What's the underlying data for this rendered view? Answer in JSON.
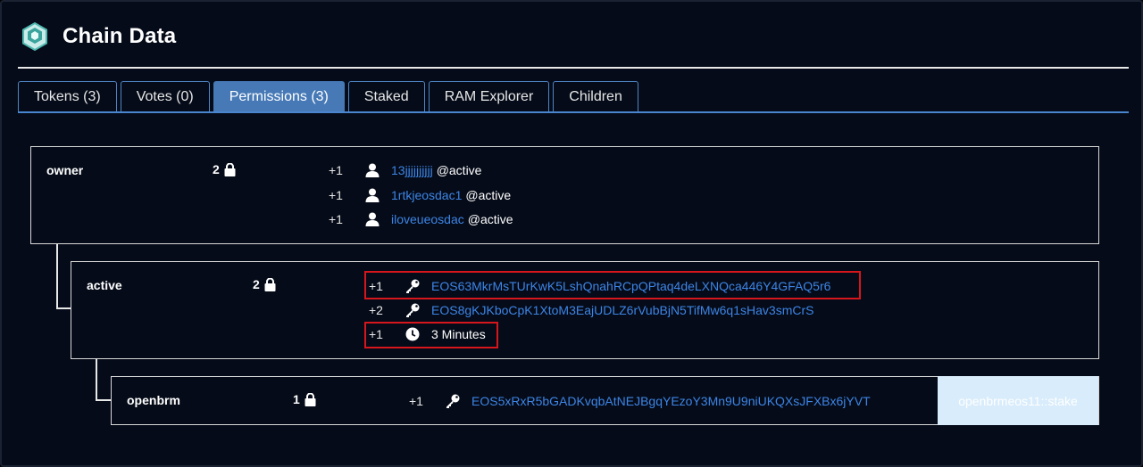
{
  "header": {
    "title": "Chain Data",
    "logo_icon": "chain-cube-icon"
  },
  "tabs": [
    {
      "label": "Tokens (3)",
      "active": false
    },
    {
      "label": "Votes (0)",
      "active": false
    },
    {
      "label": "Permissions (3)",
      "active": true
    },
    {
      "label": "Staked",
      "active": false
    },
    {
      "label": "RAM Explorer",
      "active": false
    },
    {
      "label": "Children",
      "active": false
    }
  ],
  "permissions": {
    "owner": {
      "name": "owner",
      "threshold": "2",
      "entries": [
        {
          "weight": "+1",
          "icon": "user-icon",
          "account": "13jjjjjjjjjj",
          "perm": "@active"
        },
        {
          "weight": "+1",
          "icon": "user-icon",
          "account": "1rtkjeosdac1",
          "perm": "@active"
        },
        {
          "weight": "+1",
          "icon": "user-icon",
          "account": "iloveueosdac",
          "perm": "@active"
        }
      ]
    },
    "active": {
      "name": "active",
      "threshold": "2",
      "entries": [
        {
          "weight": "+1",
          "icon": "key-icon",
          "key": "EOS63MkrMsTUrKwK5LshQnahRCpQPtaq4deLXNQca446Y4GFAQ5r6"
        },
        {
          "weight": "+2",
          "icon": "key-icon",
          "key": "EOS8gKJKboCpK1XtoM3EajUDLZ6rVubBjN5TifMw6q1sHav3smCrS"
        },
        {
          "weight": "+1",
          "icon": "clock-icon",
          "wait": "3 Minutes"
        }
      ]
    },
    "openbrm": {
      "name": "openbrm",
      "threshold": "1",
      "entries": [
        {
          "weight": "+1",
          "icon": "key-icon",
          "key": "EOS5xRxR5bGADKvqbAtNEJBgqYEzoY3Mn9U9niUKQXsJFXBx6jYVT"
        }
      ],
      "linked_action": "openbrmeos11::stake"
    }
  },
  "colors": {
    "accent": "#4679b6",
    "link": "#3d85e6",
    "highlight": "#d6161c",
    "background": "#050b18"
  }
}
